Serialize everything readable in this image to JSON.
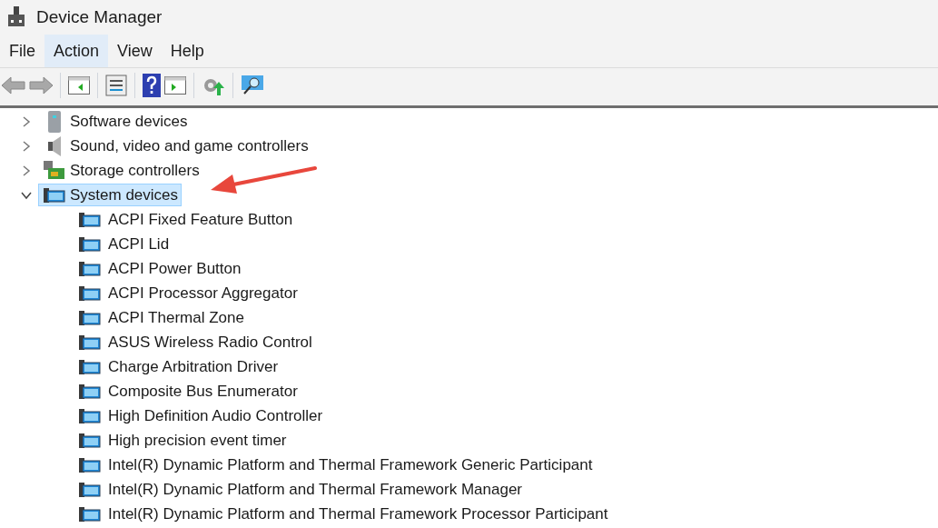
{
  "window": {
    "title": "Device Manager"
  },
  "menu": [
    {
      "label": "File",
      "selected": false
    },
    {
      "label": "Action",
      "selected": true
    },
    {
      "label": "View",
      "selected": false
    },
    {
      "label": "Help",
      "selected": false
    }
  ],
  "tree": [
    {
      "label": "Software devices",
      "kind": "software",
      "expanded": false,
      "selected": false
    },
    {
      "label": "Sound, video and game controllers",
      "kind": "sound",
      "expanded": false,
      "selected": false
    },
    {
      "label": "Storage controllers",
      "kind": "storage",
      "expanded": false,
      "selected": false
    },
    {
      "label": "System devices",
      "kind": "system",
      "expanded": true,
      "selected": true,
      "children": [
        {
          "label": "ACPI Fixed Feature Button"
        },
        {
          "label": "ACPI Lid"
        },
        {
          "label": "ACPI Power Button"
        },
        {
          "label": "ACPI Processor Aggregator"
        },
        {
          "label": "ACPI Thermal Zone"
        },
        {
          "label": "ASUS Wireless Radio Control"
        },
        {
          "label": "Charge Arbitration Driver"
        },
        {
          "label": "Composite Bus Enumerator"
        },
        {
          "label": "High Definition Audio Controller"
        },
        {
          "label": "High precision event timer"
        },
        {
          "label": "Intel(R) Dynamic Platform and Thermal Framework Generic Participant"
        },
        {
          "label": "Intel(R) Dynamic Platform and Thermal Framework Manager"
        },
        {
          "label": "Intel(R) Dynamic Platform and Thermal Framework Processor Participant"
        }
      ]
    }
  ]
}
